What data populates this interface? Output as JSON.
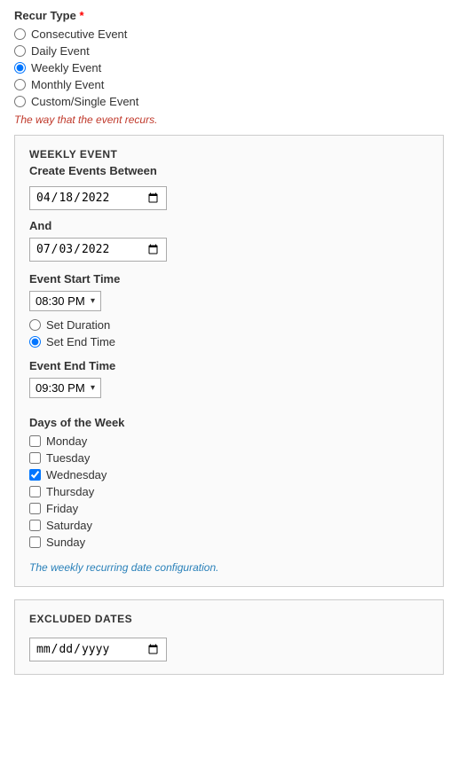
{
  "recur_type": {
    "label": "Recur Type",
    "required": true,
    "hint": "The way that the event recurs.",
    "options": [
      {
        "id": "consecutive",
        "label": "Consecutive Event",
        "checked": false
      },
      {
        "id": "daily",
        "label": "Daily Event",
        "checked": false
      },
      {
        "id": "weekly",
        "label": "Weekly Event",
        "checked": true
      },
      {
        "id": "monthly",
        "label": "Monthly Event",
        "checked": false
      },
      {
        "id": "custom",
        "label": "Custom/Single Event",
        "checked": false
      }
    ]
  },
  "weekly_panel": {
    "title": "WEEKLY EVENT",
    "subtitle": "Create Events Between",
    "start_date": "2022-04-18",
    "start_date_display": "18/04/2022",
    "and_label": "And",
    "end_date": "2022-07-03",
    "end_date_display": "03/07/2022",
    "event_start_time_label": "Event Start Time",
    "event_start_time": "08:30 PM",
    "duration_label": "Set Duration",
    "end_time_label": "Set End Time",
    "event_end_time_label": "Event End Time",
    "event_end_time": "09:30 PM",
    "days_label": "Days of the Week",
    "days": [
      {
        "id": "monday",
        "label": "Monday",
        "checked": false
      },
      {
        "id": "tuesday",
        "label": "Tuesday",
        "checked": false
      },
      {
        "id": "wednesday",
        "label": "Wednesday",
        "checked": true
      },
      {
        "id": "thursday",
        "label": "Thursday",
        "checked": false
      },
      {
        "id": "friday",
        "label": "Friday",
        "checked": false
      },
      {
        "id": "saturday",
        "label": "Saturday",
        "checked": false
      },
      {
        "id": "sunday",
        "label": "Sunday",
        "checked": false
      }
    ],
    "hint": "The weekly recurring date configuration."
  },
  "excluded_panel": {
    "title": "EXCLUDED DATES"
  }
}
